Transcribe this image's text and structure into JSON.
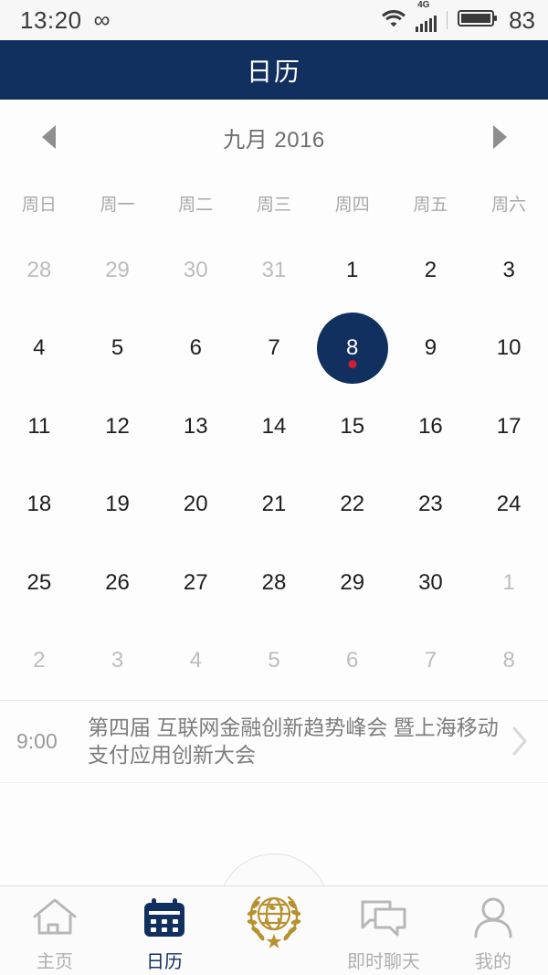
{
  "statusbar": {
    "time": "13:20",
    "infinity_icon": "∞",
    "wifi_icon": "wifi-icon",
    "network_label": "4G",
    "battery_level": "83"
  },
  "titlebar": {
    "title": "日历"
  },
  "month_nav": {
    "prev_icon": "triangle-left-icon",
    "next_icon": "triangle-right-icon",
    "label": "九月 2016"
  },
  "weekdays": [
    "周日",
    "周一",
    "周二",
    "周三",
    "周四",
    "周五",
    "周六"
  ],
  "calendar": {
    "selected_day": "8",
    "accent_color": "#12305f",
    "dot_color": "#cf2033",
    "days": [
      {
        "n": "28",
        "muted": true
      },
      {
        "n": "29",
        "muted": true
      },
      {
        "n": "30",
        "muted": true
      },
      {
        "n": "31",
        "muted": true
      },
      {
        "n": "1",
        "muted": false
      },
      {
        "n": "2",
        "muted": false
      },
      {
        "n": "3",
        "muted": false
      },
      {
        "n": "4",
        "muted": false
      },
      {
        "n": "5",
        "muted": false
      },
      {
        "n": "6",
        "muted": false
      },
      {
        "n": "7",
        "muted": false
      },
      {
        "n": "8",
        "muted": false,
        "selected": true,
        "dot": true
      },
      {
        "n": "9",
        "muted": false
      },
      {
        "n": "10",
        "muted": false
      },
      {
        "n": "11",
        "muted": false
      },
      {
        "n": "12",
        "muted": false
      },
      {
        "n": "13",
        "muted": false
      },
      {
        "n": "14",
        "muted": false
      },
      {
        "n": "15",
        "muted": false
      },
      {
        "n": "16",
        "muted": false
      },
      {
        "n": "17",
        "muted": false
      },
      {
        "n": "18",
        "muted": false
      },
      {
        "n": "19",
        "muted": false
      },
      {
        "n": "20",
        "muted": false
      },
      {
        "n": "21",
        "muted": false
      },
      {
        "n": "22",
        "muted": false
      },
      {
        "n": "23",
        "muted": false
      },
      {
        "n": "24",
        "muted": false
      },
      {
        "n": "25",
        "muted": false
      },
      {
        "n": "26",
        "muted": false
      },
      {
        "n": "27",
        "muted": false
      },
      {
        "n": "28",
        "muted": false
      },
      {
        "n": "29",
        "muted": false
      },
      {
        "n": "30",
        "muted": false
      },
      {
        "n": "1",
        "muted": true
      },
      {
        "n": "2",
        "muted": true
      },
      {
        "n": "3",
        "muted": true
      },
      {
        "n": "4",
        "muted": true
      },
      {
        "n": "5",
        "muted": true
      },
      {
        "n": "6",
        "muted": true
      },
      {
        "n": "7",
        "muted": true
      },
      {
        "n": "8",
        "muted": true
      }
    ]
  },
  "events": [
    {
      "time": "9:00",
      "title": "第四届 互联网金融创新趋势峰会 暨上海移动支付应用创新大会",
      "chevron_icon": "chevron-right-icon"
    }
  ],
  "tabbar": {
    "items": [
      {
        "label": "主页",
        "icon": "home-icon",
        "active": false
      },
      {
        "label": "日历",
        "icon": "calendar-icon",
        "active": true
      },
      {
        "label": "",
        "icon": "globe-laurel-emblem-icon",
        "active": false
      },
      {
        "label": "即时聊天",
        "icon": "chat-bubbles-icon",
        "active": false
      },
      {
        "label": "我的",
        "icon": "person-icon",
        "active": false
      }
    ]
  }
}
